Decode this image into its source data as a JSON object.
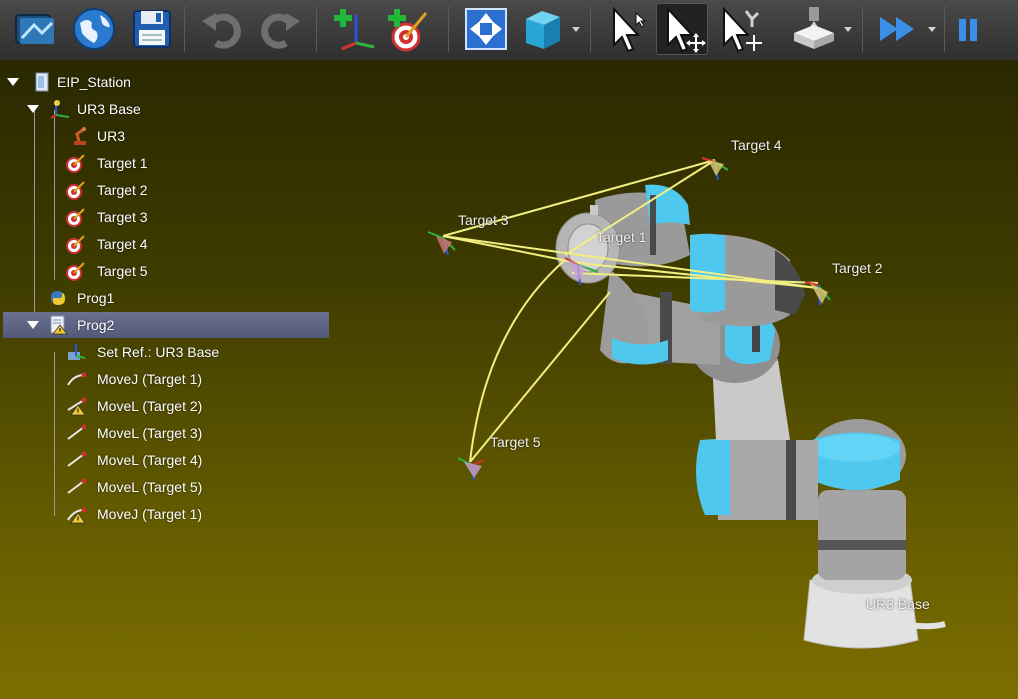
{
  "toolbar": {
    "buttons": [
      {
        "name": "open-station-button",
        "icon": "station-icon"
      },
      {
        "name": "open-library-button",
        "icon": "globe-icon"
      },
      {
        "name": "save-button",
        "icon": "save-icon"
      },
      {
        "name": "undo-button",
        "icon": "undo-icon"
      },
      {
        "name": "redo-button",
        "icon": "redo-icon"
      },
      {
        "name": "add-reference-frame-button",
        "icon": "add-frame-icon"
      },
      {
        "name": "add-target-button",
        "icon": "add-target-icon"
      },
      {
        "name": "fit-all-button",
        "icon": "fit-all-icon"
      },
      {
        "name": "view-cube-button",
        "icon": "cube-icon"
      },
      {
        "name": "select-button",
        "icon": "cursor-icon"
      },
      {
        "name": "move-button",
        "icon": "cursor-move-icon"
      },
      {
        "name": "move-robot-button",
        "icon": "cursor-robot-icon"
      },
      {
        "name": "collision-button",
        "icon": "machine-icon"
      },
      {
        "name": "fast-simulation-button",
        "icon": "fast-forward-icon"
      },
      {
        "name": "pause-button",
        "icon": "pause-icon"
      }
    ]
  },
  "tree": {
    "station": "EIP_Station",
    "base": "UR3 Base",
    "robot": "UR3",
    "targets": [
      "Target 1",
      "Target 2",
      "Target 3",
      "Target 4",
      "Target 5"
    ],
    "prog1": "Prog1",
    "prog2": "Prog2",
    "prog2_items": [
      {
        "label": "Set Ref.: UR3 Base",
        "icon": "reference-icon",
        "warning": false
      },
      {
        "label": "MoveJ (Target 1)",
        "icon": "movej-icon",
        "warning": false
      },
      {
        "label": "MoveL (Target 2)",
        "icon": "movel-icon",
        "warning": true
      },
      {
        "label": "MoveL (Target 3)",
        "icon": "movel-icon",
        "warning": false
      },
      {
        "label": "MoveL (Target 4)",
        "icon": "movel-icon",
        "warning": false
      },
      {
        "label": "MoveL (Target 5)",
        "icon": "movel-icon",
        "warning": false
      },
      {
        "label": "MoveJ (Target 1)",
        "icon": "movej-icon",
        "warning": true
      }
    ]
  },
  "scene": {
    "labels": {
      "target1": "Target 1",
      "target2": "Target 2",
      "target3": "Target 3",
      "target4": "Target 4",
      "target5": "Target 5",
      "base": "UR3 Base"
    }
  },
  "colors": {
    "robot_accent": "#4fc8f0",
    "robot_body": "#a9a9a9",
    "path_line": "#f2ef80",
    "selected_row": "#5f6684"
  }
}
